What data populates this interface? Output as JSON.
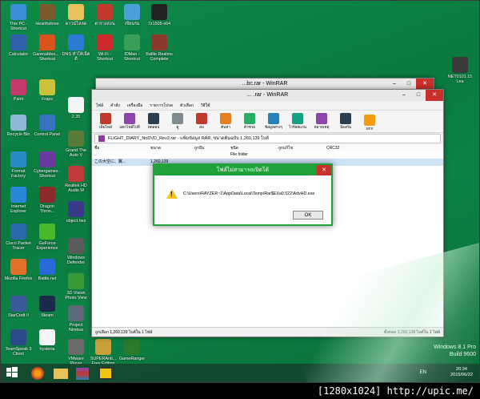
{
  "desktop_icons": [
    {
      "label": "This PC - Shortcut",
      "color": "#3a8fd6"
    },
    {
      "label": "Hearthstone",
      "color": "#7b5a2e"
    },
    {
      "label": "ดาวน์โหลด",
      "color": "#e8c15a"
    },
    {
      "label": "ตารางสอน",
      "color": "#c23a2b"
    },
    {
      "label": "เขียนรม",
      "color": "#4aa0d8"
    },
    {
      "label": "7z1505-x64",
      "color": "#222222"
    },
    {
      "label": "Calculator",
      "color": "#2f5fa8"
    },
    {
      "label": "GarenaMes... - Shortcut",
      "color": "#d9531e"
    },
    {
      "label": "DNS ทำให้เน็ตดี",
      "color": "#2a7bd1"
    },
    {
      "label": "Wi-Fi - Shortcut",
      "color": "#cc2a2a"
    },
    {
      "label": "IDMan - Shortcut",
      "color": "#3a9e56"
    },
    {
      "label": "Battle Realms Complete",
      "color": "#8a3a2a"
    },
    {
      "label": "Paint",
      "color": "#c23a6b"
    },
    {
      "label": "Fraps",
      "color": "#c9c23a"
    },
    {
      "label": "2.35",
      "color": "#f5f5f5"
    },
    {
      "label": "Recycle Bin",
      "color": "#8fb7d6"
    },
    {
      "label": "Control Panel",
      "color": "#3a72c2"
    },
    {
      "label": "Grand The Auto V",
      "color": "#5a7a3a"
    },
    {
      "label": "Format Factory",
      "color": "#2a8ac4"
    },
    {
      "label": "Cybergames - Shortcut",
      "color": "#6a3aa0"
    },
    {
      "label": "Realtek HD Audio M",
      "color": "#c03a3a"
    },
    {
      "label": "Internet Explorer",
      "color": "#2a86d8"
    },
    {
      "label": "Dragon Thron...",
      "color": "#8a2a2a"
    },
    {
      "label": "object.hes",
      "color": "#3a3a8a"
    },
    {
      "label": "Cisco Packet Tracer",
      "color": "#2a6aa8"
    },
    {
      "label": "GeForce Experience",
      "color": "#4ab82a"
    },
    {
      "label": "Windows Defender",
      "color": "#5a5a5a"
    },
    {
      "label": "Mozilla Firefox",
      "color": "#e0702a"
    },
    {
      "label": "Battle.net",
      "color": "#2a6ad8"
    },
    {
      "label": "3D Vision Photo View",
      "color": "#3a9a3a"
    },
    {
      "label": "StarCraft II",
      "color": "#3a5a9a"
    },
    {
      "label": "Steam",
      "color": "#1a2a4a"
    },
    {
      "label": "Project Nimbus",
      "color": "#5a6a7a"
    },
    {
      "label": "TeamSpeak 3 Client",
      "color": "#2a4a8a"
    },
    {
      "label": "hysteria",
      "color": "#f5f5f5"
    },
    {
      "label": "VMware Player",
      "color": "#6a6a6a"
    },
    {
      "label": "SUPERAnti... Free Edition",
      "color": "#c8a03a"
    },
    {
      "label": "GameRanger",
      "color": "#2a7a2a"
    },
    {
      "label": "NET0101 15 Lea",
      "color": "#3a3a3a"
    }
  ],
  "rar_back": {
    "title": "...bc.rar - WinRAR"
  },
  "rar_front": {
    "title": "... .rar - WinRAR",
    "menu": [
      "ไฟล์",
      "คำสั่ง",
      "เครื่องมือ",
      "รายการโปรด",
      "ตัวเลือก",
      "วิธีใช้"
    ],
    "tools": [
      {
        "label": "เพิ่มไฟล์",
        "color": "#c0392b"
      },
      {
        "label": "แตกไฟล์ไปที่",
        "color": "#8e44ad"
      },
      {
        "label": "ทดสอบ",
        "color": "#2c3e50"
      },
      {
        "label": "ดู",
        "color": "#7f8c8d"
      },
      {
        "label": "ลบ",
        "color": "#c0392b"
      },
      {
        "label": "ค้นหา",
        "color": "#e67e22"
      },
      {
        "label": "ตัวช่วย",
        "color": "#27ae60"
      },
      {
        "label": "ข้อมูลต่างๆ",
        "color": "#2980b9"
      },
      {
        "label": "ไวรัสสแกน",
        "color": "#16a085"
      },
      {
        "label": "หมายเหตุ",
        "color": "#8e44ad"
      },
      {
        "label": "ป้องกัน",
        "color": "#2c3e50"
      },
      {
        "label": "SFX",
        "color": "#f39c12"
      }
    ],
    "path": "FLIGHT_DIARY_NoDVD_Rev2.rar - แฟ้มข้อมูล RAR, ขนาดต้นฉบับ 1,260,139 ไบต์",
    "columns": [
      "ชื่อ",
      "ขนาด",
      "ถูกบีบ",
      "ชนิด",
      "ถูกแก้ไข",
      "CRC32"
    ],
    "rows": [
      {
        "name": "..",
        "size": "",
        "packed": "",
        "type": "File folder",
        "modified": "",
        "crc": ""
      },
      {
        "name": "この大空に、翼...",
        "size": "1,260,139",
        "packed": "",
        "type": "",
        "modified": "",
        "crc": ""
      }
    ],
    "status_left": "ถูกเลือก 1,260,139 ไบต์ใน 1 ไฟล์",
    "status_right": "ทั้งหมด 1,260,139 ไบต์ใน 1 ไฟล์"
  },
  "dialog": {
    "title": "ไฟล์ไม่สามารถเปิดได้",
    "message": "C:\\Users\\RAYZER~1\\AppData\\Local\\Temp\\Rar$EXa0.522\\AdvHD.exe",
    "ok_label": "OK"
  },
  "watermark": {
    "line1": "Windows 8.1 Pro",
    "line2": "Build 9600"
  },
  "taskbar": {
    "lang": "EN",
    "time": "20:34",
    "date": "2015/06/22"
  },
  "footer": "[1280x1024] http://upic.me/"
}
